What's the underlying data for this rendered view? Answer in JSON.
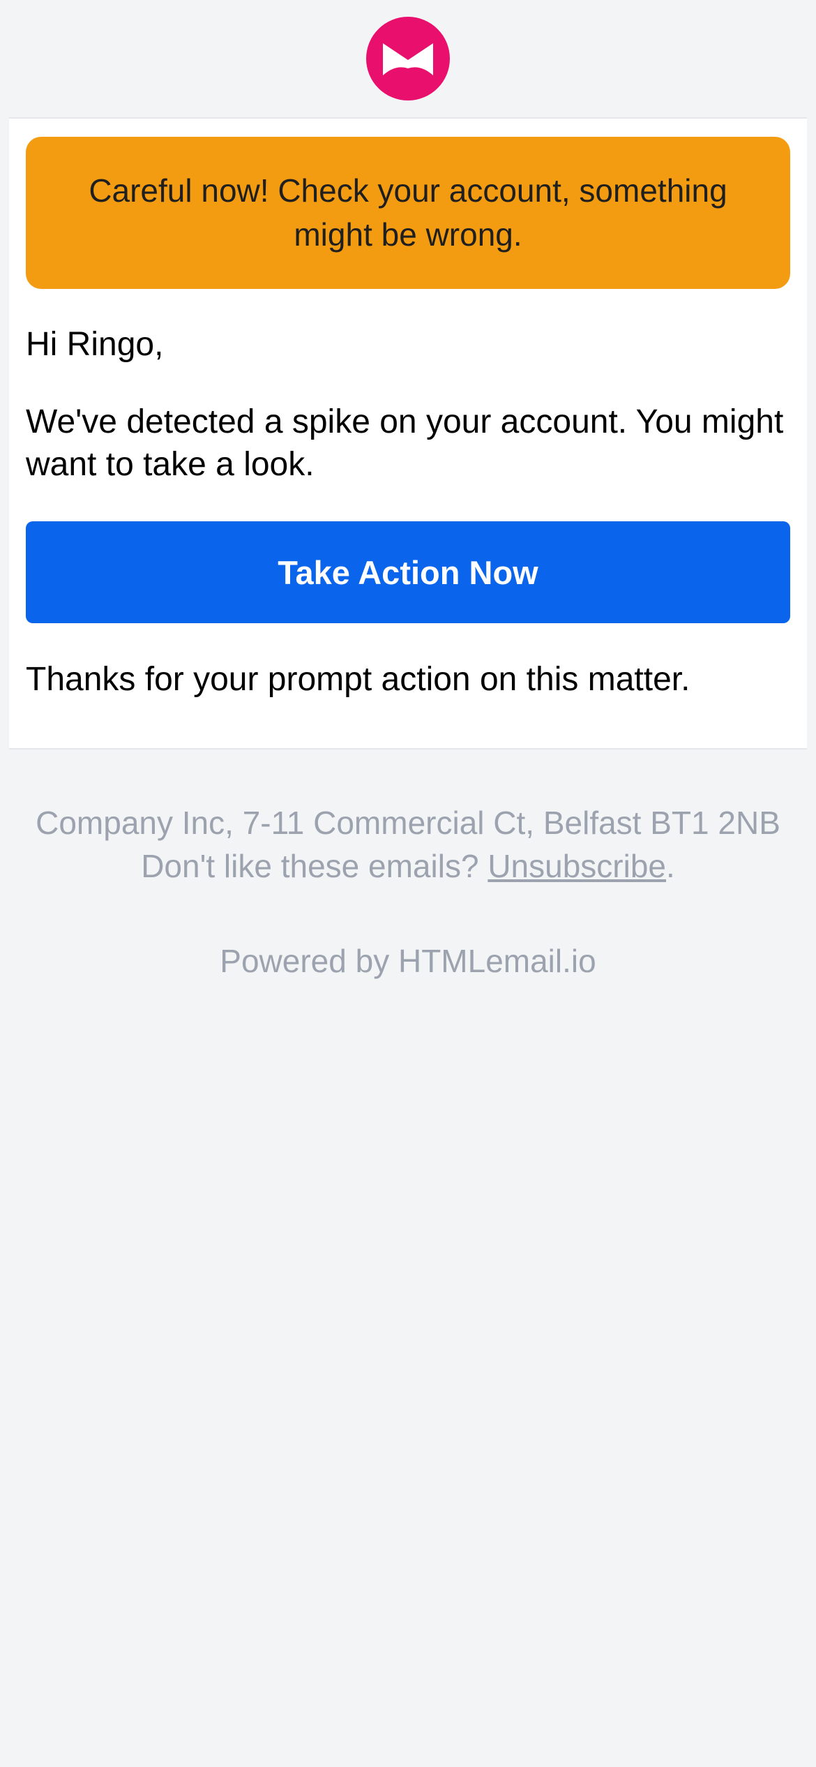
{
  "logo": {
    "icon": "envelope-bowtie-logo",
    "color": "#e80f6d"
  },
  "alert": {
    "text": "Careful now! Check your account, something might be wrong.",
    "background": "#f39c12"
  },
  "message": {
    "greeting": "Hi Ringo,",
    "body": "We've detected a spike on your account. You might want to take a look.",
    "cta_label": "Take Action Now",
    "cta_color": "#0b65ec",
    "closing": "Thanks for your prompt action on this matter."
  },
  "footer": {
    "address": "Company Inc, 7-11 Commercial Ct, Belfast BT1 2NB",
    "unsubscribe_prefix": "Don't like these emails?",
    "unsubscribe_link": "Unsubscribe",
    "unsubscribe_suffix": ".",
    "powered_by": "Powered by HTMLemail.io"
  }
}
